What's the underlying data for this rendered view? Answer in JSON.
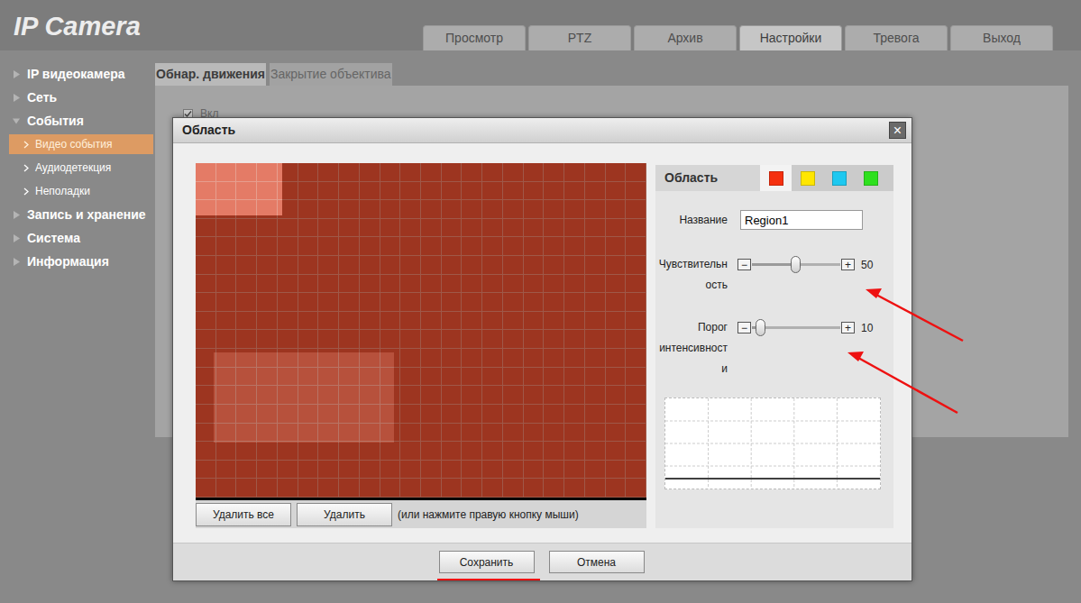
{
  "logo": "IP Camera",
  "tabs": [
    {
      "label": "Просмотр",
      "selected": false
    },
    {
      "label": "PTZ",
      "selected": false
    },
    {
      "label": "Архив",
      "selected": false
    },
    {
      "label": "Настройки",
      "selected": true
    },
    {
      "label": "Тревога",
      "selected": false
    },
    {
      "label": "Выход",
      "selected": false
    }
  ],
  "sidebar": {
    "items": [
      {
        "label": "IP видеокамера",
        "kind": "section",
        "expanded": false,
        "selected": false
      },
      {
        "label": "Сеть",
        "kind": "section",
        "expanded": false,
        "selected": false
      },
      {
        "label": "События",
        "kind": "section",
        "expanded": true,
        "selected": false
      },
      {
        "label": "Видео события",
        "kind": "sub",
        "expanded": false,
        "selected": true
      },
      {
        "label": "Аудиодетекция",
        "kind": "sub",
        "expanded": false,
        "selected": false
      },
      {
        "label": "Неполадки",
        "kind": "sub",
        "expanded": false,
        "selected": false
      },
      {
        "label": "Запись и хранение",
        "kind": "section",
        "expanded": false,
        "selected": false
      },
      {
        "label": "Система",
        "kind": "section",
        "expanded": false,
        "selected": false
      },
      {
        "label": "Информация",
        "kind": "section",
        "expanded": false,
        "selected": false
      }
    ]
  },
  "subtabs": [
    {
      "label": "Обнар. движения",
      "selected": true
    },
    {
      "label": "Закрытие объектива",
      "selected": false
    }
  ],
  "enable": {
    "label": "Вкл",
    "checked": true
  },
  "dialog": {
    "title": "Область",
    "close": "×",
    "video_buttons": [
      "Удалить все",
      "Удалить"
    ],
    "video_hint": "(или нажмите правую кнопку мыши)",
    "panel": {
      "title": "Область",
      "regions": [
        {
          "color": "#f5300f",
          "selected": true
        },
        {
          "color": "#ffe600",
          "selected": false
        },
        {
          "color": "#1ec8f0",
          "selected": false
        },
        {
          "color": "#2ee01e",
          "selected": false
        }
      ],
      "name": {
        "label": "Название",
        "value": "Region1"
      },
      "sliders": [
        {
          "label": "Чувствительность",
          "level": 0.5,
          "reading": "50",
          "minus": "−",
          "plus": "+"
        },
        {
          "label": "Порог интенсивности",
          "level": 0.1,
          "reading": "10",
          "minus": "−",
          "plus": "+"
        }
      ],
      "chart": {
        "values": [
          0,
          0,
          0,
          0,
          0,
          0,
          0,
          0,
          0,
          0,
          0,
          0
        ]
      }
    },
    "buttons": [
      {
        "label": "Сохранить",
        "highlighted": true
      },
      {
        "label": "Отмена",
        "highlighted": false
      }
    ]
  }
}
